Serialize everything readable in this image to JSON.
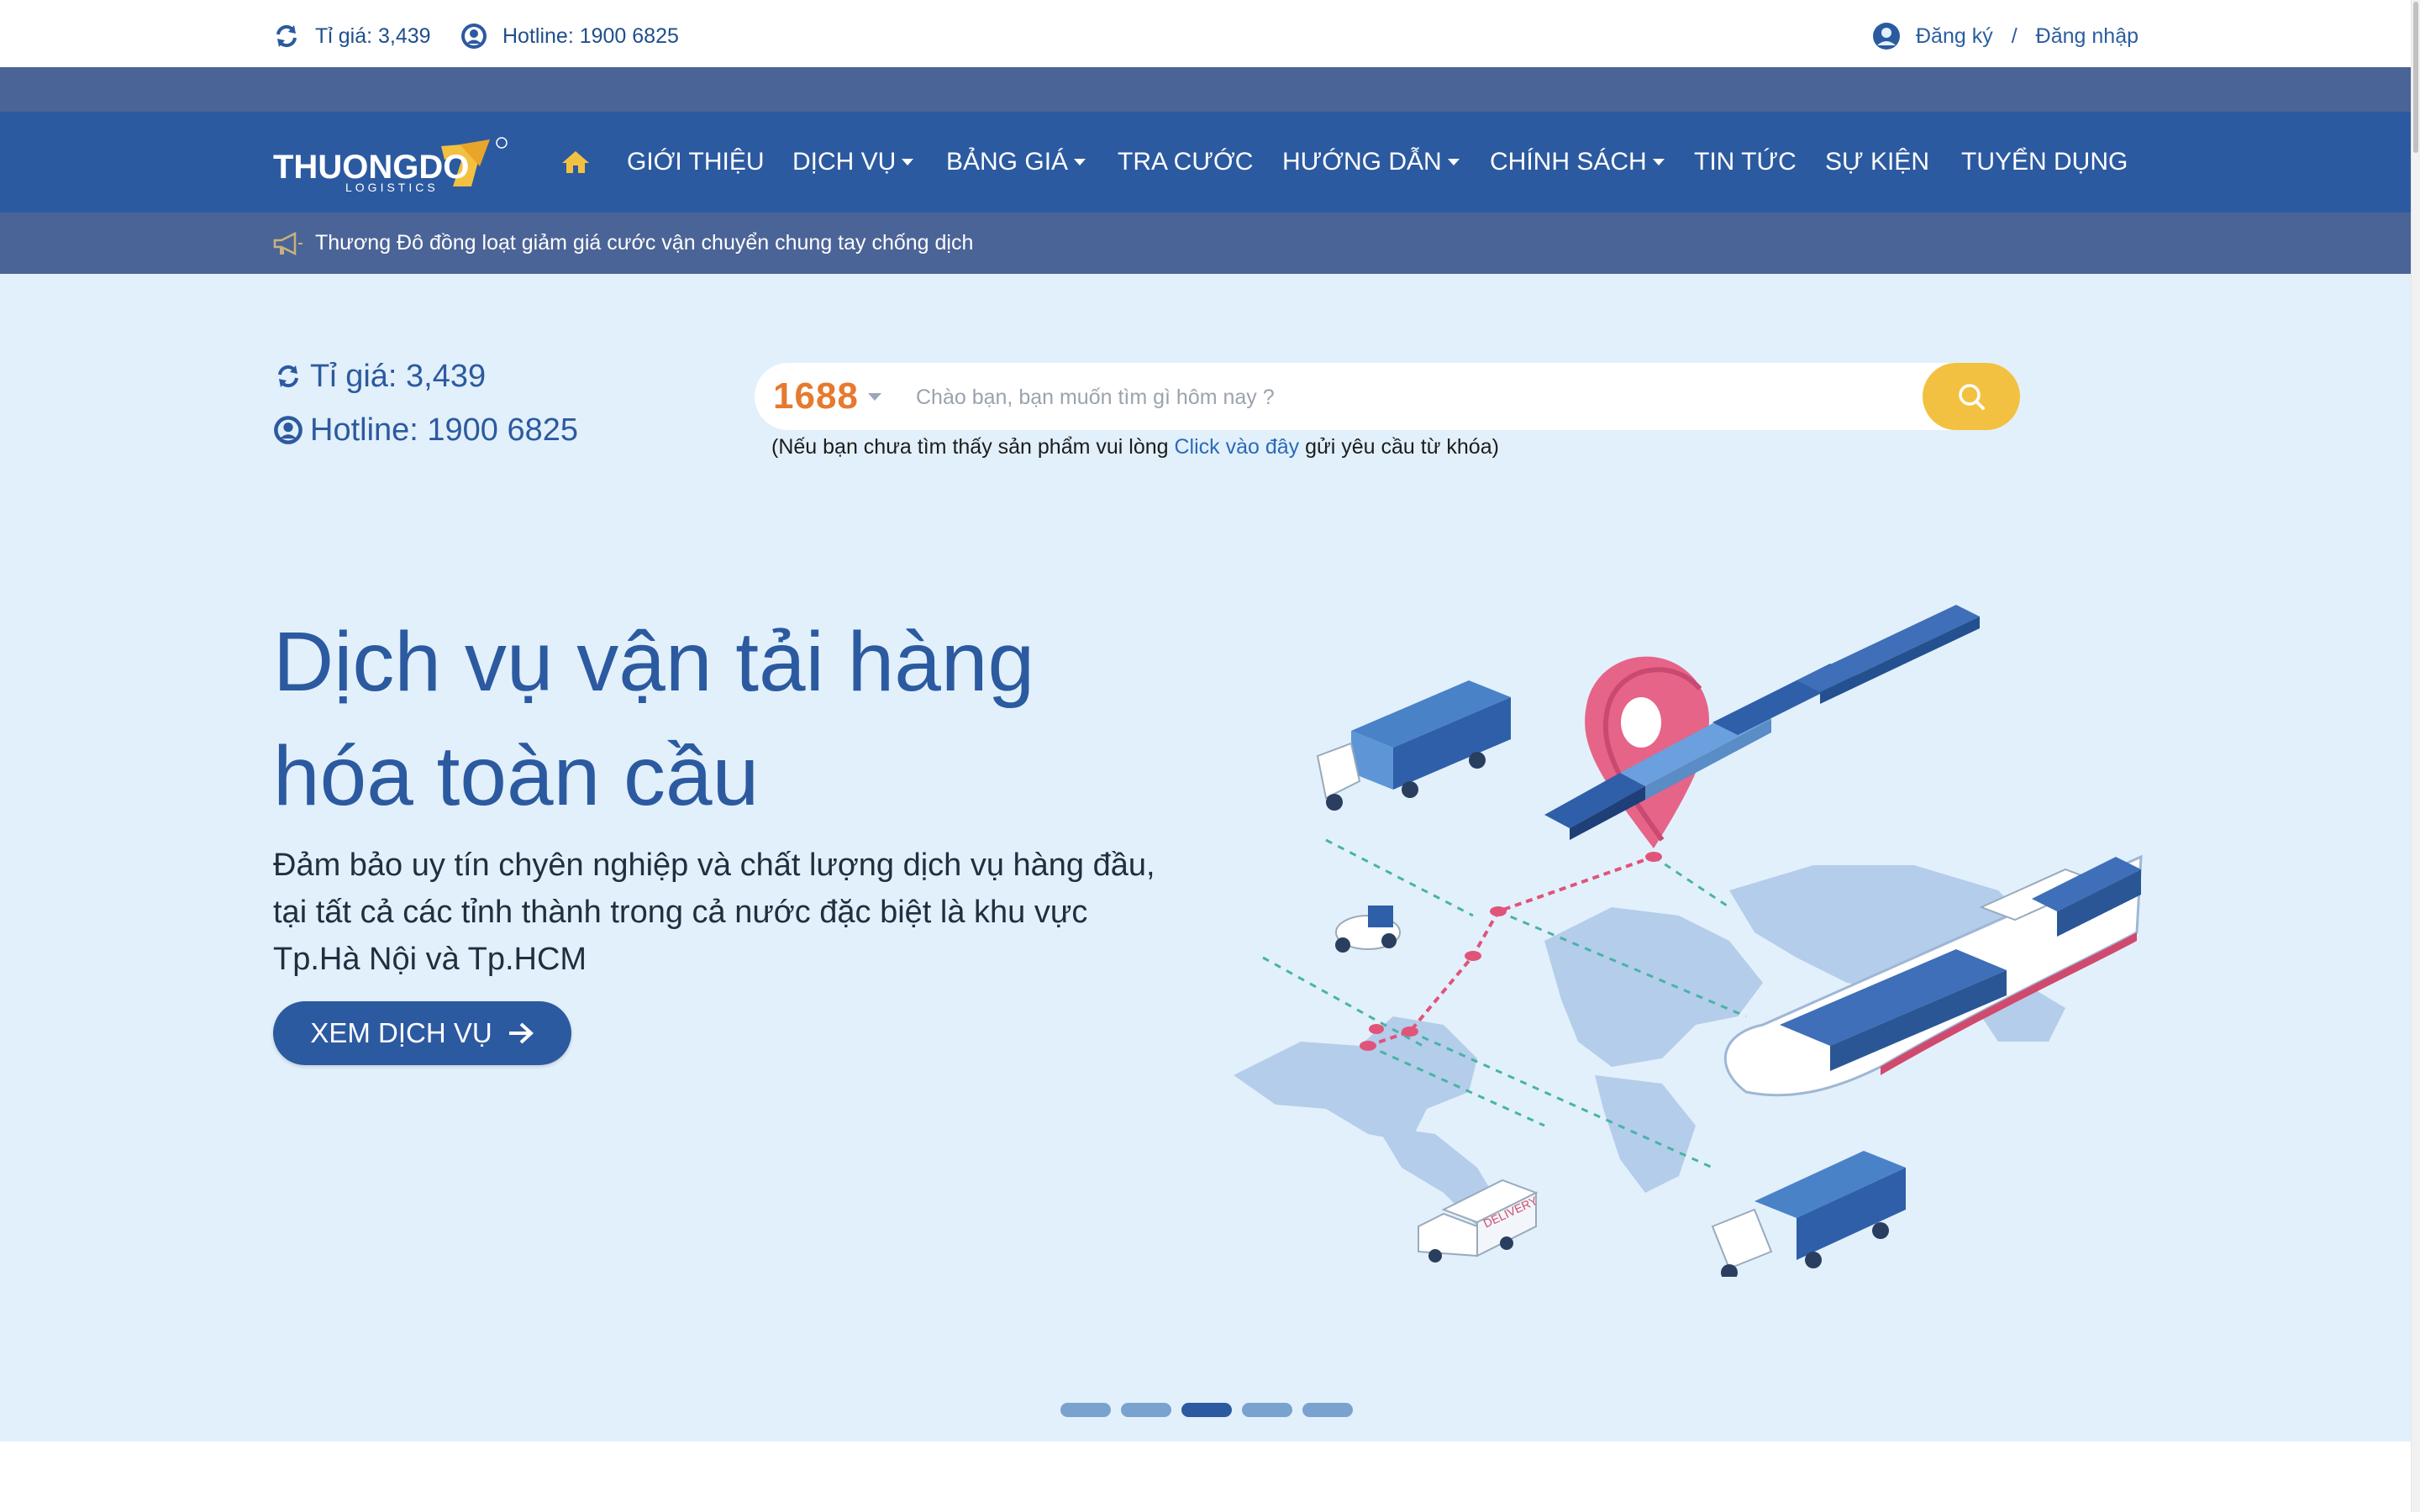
{
  "topbar": {
    "rate": "Tỉ giá: 3,439",
    "hotline": "Hotline: 1900 6825",
    "register": "Đăng ký",
    "separator": "/",
    "login": "Đăng nhập"
  },
  "logo": {
    "text": "THUONGDO",
    "sub": "LOGISTICS"
  },
  "nav": {
    "items": [
      {
        "label": "GIỚI THIỆU",
        "dropdown": false
      },
      {
        "label": "DỊCH VỤ",
        "dropdown": true
      },
      {
        "label": "BẢNG GIÁ",
        "dropdown": true
      },
      {
        "label": "TRA CƯỚC",
        "dropdown": false
      },
      {
        "label": "HƯỚNG DẪN",
        "dropdown": true
      },
      {
        "label": "CHÍNH SÁCH",
        "dropdown": true
      },
      {
        "label": "TIN TỨC",
        "dropdown": false
      },
      {
        "label": "SỰ KIỆN",
        "dropdown": false
      },
      {
        "label": "TUYỂN DỤNG",
        "dropdown": false
      }
    ]
  },
  "notice": "Thương Đô đồng loạt giảm giá cước vận chuyển chung tay chống dịch",
  "info": {
    "rate": "Tỉ giá: 3,439",
    "hotline": "Hotline: 1900 6825"
  },
  "search": {
    "site": "1688",
    "placeholder": "Chào bạn, bạn muốn tìm gì hôm nay ?",
    "note_before": "(Nếu bạn chưa tìm thấy sản phẩm vui lòng ",
    "note_link": "Click vào đây",
    "note_after": " gửi yêu cầu từ khóa)"
  },
  "hero": {
    "title_line1": "Dịch vụ vận tải hàng",
    "title_line2": "hóa toàn cầu",
    "desc_line1": "Đảm bảo uy tín chyên nghiệp và chất lượng dịch vụ hàng đầu,",
    "desc_line2": "tại tất cả các tỉnh thành trong cả nước đặc biệt là khu vực",
    "desc_line3": "Tp.Hà Nội và Tp.HCM",
    "cta": "XEM DỊCH VỤ",
    "van_label": "DELIVERY"
  },
  "slider": {
    "count": 5,
    "active": 3
  },
  "colors": {
    "primary": "#2c5aa0",
    "header_band": "#4b6497",
    "hero_bg": "#e2f0fb",
    "accent": "#f3c141",
    "brand_orange": "#e67a2e"
  }
}
